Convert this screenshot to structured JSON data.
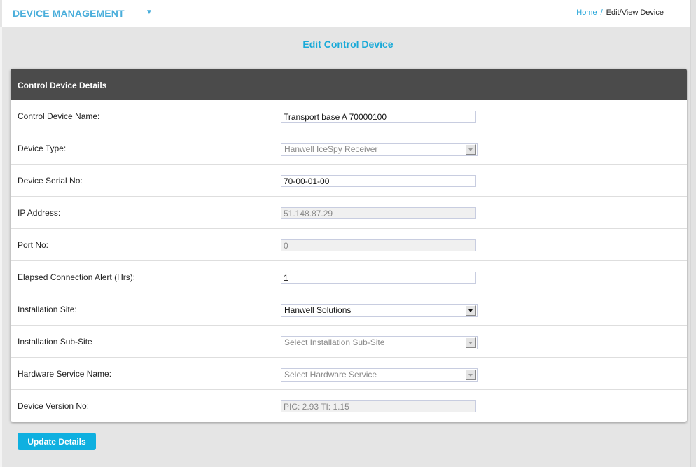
{
  "header": {
    "brand": "DEVICE MANAGEMENT",
    "brand_menu_icon": "caret-down-icon",
    "breadcrumb": {
      "home": "Home",
      "separator": "/",
      "current": "Edit/View Device"
    }
  },
  "page": {
    "title": "Edit Control Device"
  },
  "panel": {
    "title": "Control Device Details",
    "fields": [
      {
        "label": "Control Device Name:",
        "type": "text",
        "value": "Transport base A 70000100",
        "disabled": false
      },
      {
        "label": "Device Type:",
        "type": "select",
        "value": "Hanwell IceSpy Receiver",
        "disabled": true
      },
      {
        "label": "Device Serial No:",
        "type": "text",
        "value": "70-00-01-00",
        "disabled": false
      },
      {
        "label": "IP Address:",
        "type": "text",
        "value": "51.148.87.29",
        "disabled": true
      },
      {
        "label": "Port No:",
        "type": "text",
        "value": "0",
        "disabled": true
      },
      {
        "label": "Elapsed Connection Alert (Hrs):",
        "type": "text",
        "value": "1",
        "disabled": false
      },
      {
        "label": "Installation Site:",
        "type": "select",
        "value": "Hanwell Solutions",
        "disabled": false
      },
      {
        "label": "Installation Sub-Site",
        "type": "select",
        "value": "Select Installation Sub-Site",
        "disabled": true
      },
      {
        "label": "Hardware Service Name:",
        "type": "select",
        "value": "Select Hardware Service",
        "disabled": true
      },
      {
        "label": "Device Version No:",
        "type": "text",
        "value": "PIC: 2.93 TI: 1.15",
        "disabled": true
      }
    ]
  },
  "actions": {
    "update_label": "Update Details"
  },
  "colors": {
    "accent": "#1aaad8",
    "brand": "#4aaedb",
    "panel_header": "#4b4b4b",
    "button": "#0fb0e0"
  }
}
